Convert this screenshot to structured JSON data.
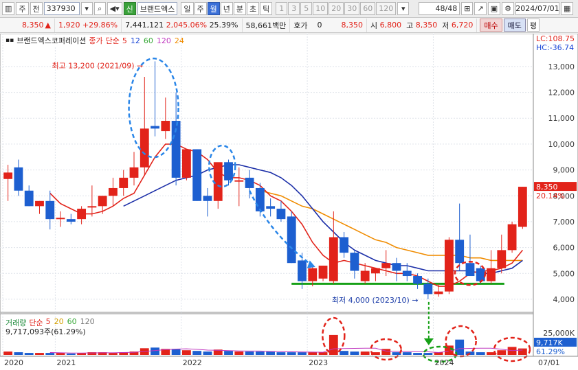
{
  "toolbar": {
    "period_label": "주",
    "prev_label": "전",
    "code": "337930",
    "sin_badge": "신",
    "stock_name": "브랜드엑스",
    "periods": [
      "일",
      "주",
      "월",
      "년",
      "분",
      "초",
      "틱"
    ],
    "active_period": "월",
    "numbers": [
      "1",
      "3",
      "5",
      "10",
      "20",
      "30",
      "60",
      "120"
    ],
    "position": "48/48",
    "date": "2024/07/01"
  },
  "quote": {
    "price": "8,350",
    "change": "1,920",
    "change_pct": "+29.86%",
    "volume": "7,441,121",
    "volume_pct": "2,045.06%",
    "turnover": "25.39%",
    "amount": "58,661백만",
    "hoga_label": "호가",
    "hoga_value": "0",
    "ask": "8,350",
    "open_label": "시",
    "open": "6,800",
    "high_label": "고",
    "high": "8,350",
    "low_label": "저",
    "low": "6,720",
    "buy": "매수",
    "sell": "매도",
    "flat": "평"
  },
  "chart_legend": {
    "title": "브랜드엑스코퍼레이션",
    "close_label": "종가",
    "ma_label": "단순",
    "ma_values": [
      "5",
      "12",
      "60",
      "120",
      "24"
    ],
    "ma_colors": [
      "#e2231a",
      "#1844d6",
      "#37a837",
      "#c038c0",
      "#f08c00"
    ],
    "lc": "LC:108.75",
    "hc": "HC:-36.74",
    "high_note": "최고 13,200 (2021/09)",
    "low_note": "최저 4,000 (2023/10)"
  },
  "volume_legend": {
    "title": "거래량",
    "ma_label": "단순",
    "ma_values": [
      "5",
      "20",
      "60",
      "120"
    ],
    "info": "9,717,093주(61.29%)",
    "axis_label": "25,000K",
    "current_badge": "9,717K",
    "current_pct": "61.29%"
  },
  "axis": {
    "price_ticks": [
      "13,000",
      "12,000",
      "11,000",
      "10,000",
      "9,000",
      "8,000",
      "7,000",
      "6,000",
      "5,000",
      "4,000"
    ],
    "current_badge": "8,350",
    "current_pct": "20.14%",
    "x_labels": [
      "2020",
      "2021",
      "2022",
      "2023",
      "2024",
      "07/01"
    ]
  },
  "colors": {
    "up": "#e2231a",
    "down": "#1d5fd0",
    "ma_red": "#e2231a",
    "ma_blue": "#1c2fa8",
    "ma_orange": "#f08c00",
    "support": "#16a016"
  },
  "chart_data": {
    "type": "candlestick",
    "x_labels": [
      "2020",
      "2021",
      "2022",
      "2023",
      "2024"
    ],
    "ylim": [
      3600,
      13900
    ],
    "candles": [
      {
        "o": 8650,
        "h": 9200,
        "l": 7800,
        "c": 8900
      },
      {
        "o": 9100,
        "h": 9400,
        "l": 8000,
        "c": 8200
      },
      {
        "o": 8200,
        "h": 8400,
        "l": 7600,
        "c": 7600
      },
      {
        "o": 7600,
        "h": 7800,
        "l": 7300,
        "c": 7800
      },
      {
        "o": 7800,
        "h": 8200,
        "l": 6700,
        "c": 7100
      },
      {
        "o": 7150,
        "h": 7400,
        "l": 6800,
        "c": 7150
      },
      {
        "o": 7100,
        "h": 7300,
        "l": 6900,
        "c": 7000
      },
      {
        "o": 7100,
        "h": 7600,
        "l": 6900,
        "c": 7500
      },
      {
        "o": 7600,
        "h": 8400,
        "l": 7200,
        "c": 7600
      },
      {
        "o": 7600,
        "h": 7900,
        "l": 7300,
        "c": 8000
      },
      {
        "o": 8000,
        "h": 8700,
        "l": 7600,
        "c": 8300
      },
      {
        "o": 8300,
        "h": 9000,
        "l": 8000,
        "c": 8700
      },
      {
        "o": 8700,
        "h": 9700,
        "l": 8400,
        "c": 9100
      },
      {
        "o": 9100,
        "h": 12600,
        "l": 8800,
        "c": 10600
      },
      {
        "o": 10700,
        "h": 13200,
        "l": 10300,
        "c": 10600
      },
      {
        "o": 10500,
        "h": 11800,
        "l": 10200,
        "c": 10900
      },
      {
        "o": 10900,
        "h": 12000,
        "l": 8400,
        "c": 8700
      },
      {
        "o": 8700,
        "h": 9800,
        "l": 8600,
        "c": 9800
      },
      {
        "o": 9800,
        "h": 9800,
        "l": 7800,
        "c": 7800
      },
      {
        "o": 8000,
        "h": 8300,
        "l": 7200,
        "c": 7800
      },
      {
        "o": 7800,
        "h": 8700,
        "l": 7500,
        "c": 9300
      },
      {
        "o": 9300,
        "h": 9400,
        "l": 8400,
        "c": 8600
      },
      {
        "o": 8600,
        "h": 9100,
        "l": 7600,
        "c": 8600
      },
      {
        "o": 8700,
        "h": 9000,
        "l": 7900,
        "c": 8300
      },
      {
        "o": 8300,
        "h": 8500,
        "l": 7200,
        "c": 7400
      },
      {
        "o": 7600,
        "h": 7900,
        "l": 7200,
        "c": 7500
      },
      {
        "o": 7500,
        "h": 7800,
        "l": 7000,
        "c": 7100
      },
      {
        "o": 7200,
        "h": 7400,
        "l": 5400,
        "c": 5400
      },
      {
        "o": 5500,
        "h": 5800,
        "l": 4400,
        "c": 4700
      },
      {
        "o": 4700,
        "h": 5300,
        "l": 4500,
        "c": 5200
      },
      {
        "o": 4800,
        "h": 5300,
        "l": 4700,
        "c": 5300
      },
      {
        "o": 4700,
        "h": 7400,
        "l": 4600,
        "c": 6400
      },
      {
        "o": 6400,
        "h": 6600,
        "l": 5600,
        "c": 5800
      },
      {
        "o": 5800,
        "h": 5900,
        "l": 4800,
        "c": 5100
      },
      {
        "o": 4700,
        "h": 5400,
        "l": 4600,
        "c": 5100
      },
      {
        "o": 5000,
        "h": 5200,
        "l": 4700,
        "c": 5200
      },
      {
        "o": 5200,
        "h": 5900,
        "l": 4900,
        "c": 5400
      },
      {
        "o": 5400,
        "h": 5600,
        "l": 4700,
        "c": 5100
      },
      {
        "o": 5100,
        "h": 5400,
        "l": 4700,
        "c": 4900
      },
      {
        "o": 4900,
        "h": 5000,
        "l": 4400,
        "c": 4600
      },
      {
        "o": 4600,
        "h": 4800,
        "l": 4000,
        "c": 4200
      },
      {
        "o": 4200,
        "h": 4600,
        "l": 4100,
        "c": 4300
      },
      {
        "o": 4300,
        "h": 6400,
        "l": 4200,
        "c": 6300
      },
      {
        "o": 6300,
        "h": 7700,
        "l": 5100,
        "c": 5400
      },
      {
        "o": 5400,
        "h": 6500,
        "l": 5000,
        "c": 4900
      },
      {
        "o": 5200,
        "h": 5300,
        "l": 4600,
        "c": 4700
      },
      {
        "o": 4700,
        "h": 5900,
        "l": 4600,
        "c": 5200
      },
      {
        "o": 5200,
        "h": 6500,
        "l": 5000,
        "c": 5900
      },
      {
        "o": 5900,
        "h": 7000,
        "l": 5800,
        "c": 6900
      },
      {
        "o": 6800,
        "h": 8350,
        "l": 6720,
        "c": 8350
      }
    ],
    "volume": [
      5,
      4,
      3,
      3,
      3,
      3,
      2,
      3,
      4,
      4,
      3,
      4,
      5,
      10,
      11,
      9,
      9,
      7,
      6,
      5,
      8,
      6,
      5,
      5,
      5,
      5,
      4,
      4,
      4,
      4,
      4,
      30,
      6,
      5,
      5,
      4,
      9,
      4,
      4,
      3,
      3,
      4,
      14,
      23,
      5,
      4,
      4,
      7,
      12,
      9.7
    ],
    "volume_ylim": [
      0,
      33
    ],
    "volume_unit": "K",
    "ma_red": [
      null,
      null,
      null,
      null,
      8100,
      7700,
      7500,
      7300,
      7300,
      7400,
      7600,
      7900,
      8100,
      8800,
      9500,
      10000,
      10000,
      9800,
      9700,
      9400,
      8900,
      8700,
      8700,
      8600,
      8400,
      8000,
      7800,
      7400,
      6900,
      6200,
      5700,
      5400,
      5500,
      5400,
      5300,
      5200,
      5100,
      5000,
      5000,
      4900,
      4700,
      4500,
      4500,
      4700,
      5000,
      5100,
      5100,
      5200,
      5400,
      5900
    ],
    "ma_blue": [
      null,
      null,
      null,
      null,
      null,
      null,
      null,
      null,
      null,
      null,
      null,
      7600,
      7800,
      8000,
      8200,
      8400,
      8600,
      8700,
      8800,
      9000,
      9100,
      9200,
      9200,
      9100,
      9000,
      8900,
      8700,
      8400,
      8000,
      7500,
      7000,
      6600,
      6200,
      5900,
      5700,
      5500,
      5400,
      5300,
      5300,
      5200,
      5100,
      5100,
      5100,
      5100,
      5100,
      5000,
      5000,
      5100,
      5200,
      5500
    ],
    "ma_orange": [
      null,
      null,
      null,
      null,
      null,
      null,
      null,
      null,
      null,
      null,
      null,
      null,
      null,
      null,
      null,
      null,
      null,
      null,
      null,
      null,
      null,
      null,
      null,
      null,
      8200,
      8100,
      8000,
      7800,
      7600,
      7500,
      7300,
      7100,
      6900,
      6700,
      6500,
      6300,
      6200,
      6000,
      5900,
      5800,
      5700,
      5700,
      5700,
      5700,
      5600,
      5600,
      5500,
      5500,
      5500,
      5500
    ],
    "support_level": 4600
  }
}
